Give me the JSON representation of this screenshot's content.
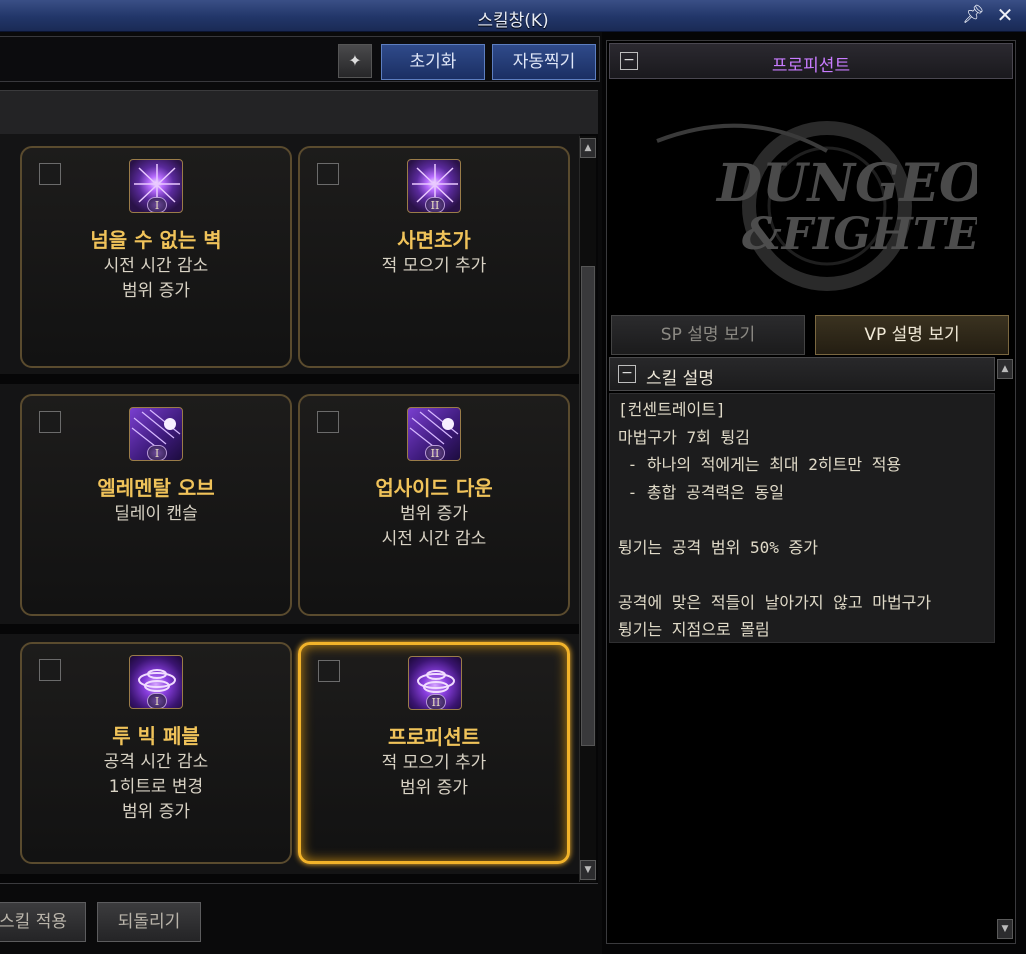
{
  "window": {
    "title": "스킬창(K)"
  },
  "toolbar": {
    "reset_label": "초기화",
    "auto_label": "자동찍기"
  },
  "skills": [
    {
      "name": "넘을 수 없는 벽",
      "desc": [
        "시전 시간 감소",
        "범위 증가"
      ],
      "rank": "I",
      "icon": "purple-burst-icon"
    },
    {
      "name": "사면초가",
      "desc": [
        "적 모으기 추가"
      ],
      "rank": "II",
      "icon": "purple-burst-icon"
    },
    {
      "name": "엘레멘탈 오브",
      "desc": [
        "딜레이 캔슬"
      ],
      "rank": "I",
      "icon": "meteor-orb-icon"
    },
    {
      "name": "업사이드 다운",
      "desc": [
        "범위 증가",
        "시전 시간 감소"
      ],
      "rank": "II",
      "icon": "meteor-orb-icon"
    },
    {
      "name": "투 빅 페블",
      "desc": [
        "공격 시간 감소",
        "1히트로 변경",
        "범위 증가"
      ],
      "rank": "I",
      "icon": "vortex-icon"
    },
    {
      "name": "프로피션트",
      "desc": [
        "적 모으기 추가",
        "범위 증가"
      ],
      "rank": "II",
      "icon": "vortex-icon",
      "selected": true
    }
  ],
  "footer": {
    "apply_label": "스킬 적용",
    "revert_label": "되돌리기"
  },
  "detail": {
    "title": "프로피션트",
    "tab_sp": "SP 설명 보기",
    "tab_vp": "VP 설명 보기",
    "section_title": "스킬 설명",
    "lines": [
      "[컨센트레이트]",
      "마법구가 7회 튕김",
      " - 하나의 적에게는 최대 2히트만 적용",
      " - 총합 공격력은 동일",
      "",
      "튕기는 공격 범위 50% 증가",
      "",
      "공격에 맞은 적들이 날아가지 않고 마법구가",
      "튕기는 지점으로 몰림"
    ]
  },
  "colors": {
    "accent_gold": "#f0c35a",
    "selected_border": "#f2b32a",
    "title_bar": "#223669",
    "detail_title": "#c87cff"
  }
}
